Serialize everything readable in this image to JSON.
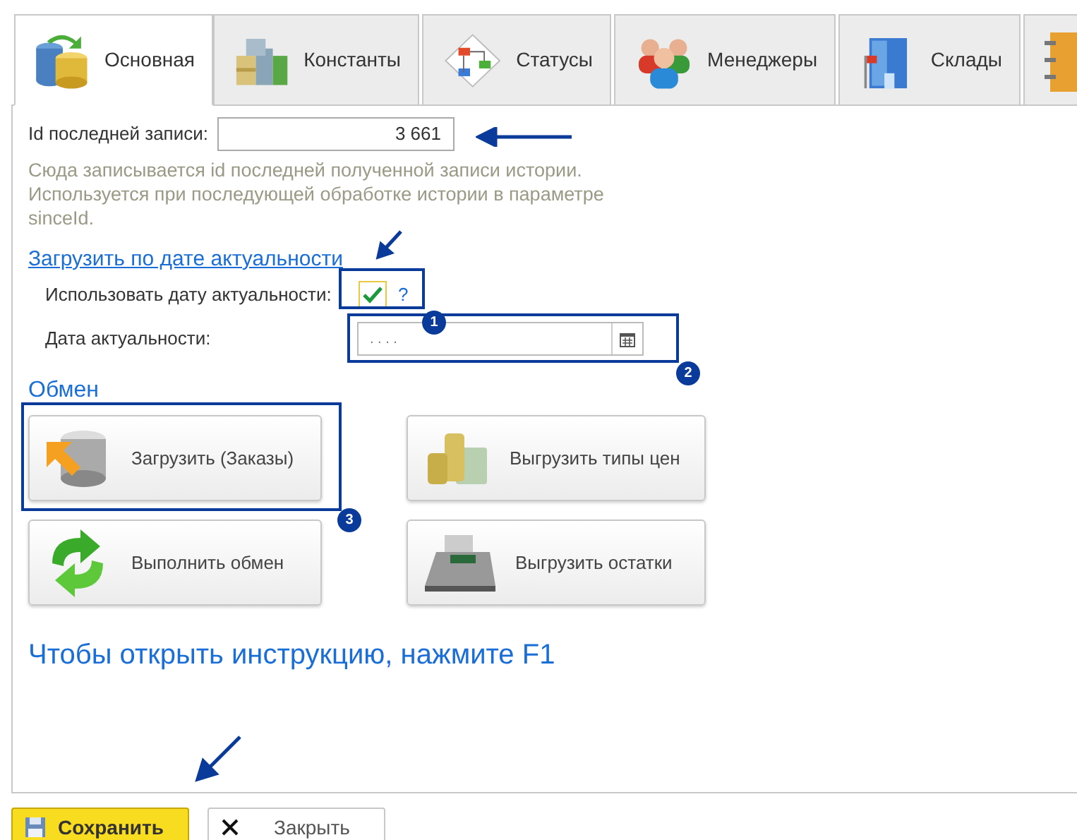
{
  "tabs": [
    {
      "label": "Основная",
      "selected": true
    },
    {
      "label": "Константы",
      "selected": false
    },
    {
      "label": "Статусы",
      "selected": false
    },
    {
      "label": "Менеджеры",
      "selected": false
    },
    {
      "label": "Склады",
      "selected": false
    },
    {
      "selected": false
    }
  ],
  "id_field": {
    "label": "Id последней записи:",
    "value": "3 661"
  },
  "id_hint": "Сюда записывается id последней полученной записи истории. Используется при последующей обработке истории в параметре sinceId.",
  "date_section": {
    "title": "Загрузить по дате актуальности",
    "checkbox": {
      "label": "Использовать дату актуальности:",
      "checked": true,
      "help": "?"
    },
    "date_field": {
      "label": "Дата актуальности:",
      "value": ". .   . ."
    }
  },
  "exchange": {
    "title": "Обмен",
    "buttons": [
      {
        "label": "Загрузить (Заказы)"
      },
      {
        "label": "Выгрузить типы цен"
      },
      {
        "label": "Выполнить обмен"
      },
      {
        "label": "Выгрузить остатки"
      }
    ]
  },
  "help_text": "Чтобы открыть инструкцию, нажмите F1",
  "footer_buttons": [
    {
      "label": "Сохранить",
      "kind": "default"
    },
    {
      "label": "Закрыть",
      "kind": "close"
    }
  ],
  "markers": [
    "1",
    "2",
    "3"
  ]
}
